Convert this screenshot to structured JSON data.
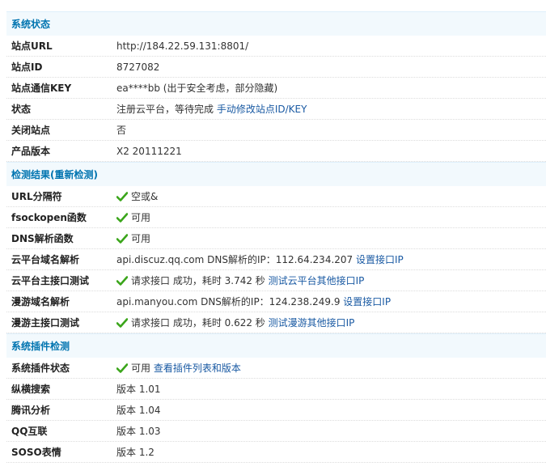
{
  "status": {
    "header": "系统状态",
    "rows": [
      {
        "label": "站点URL",
        "value": "http://184.22.59.131:8801/"
      },
      {
        "label": "站点ID",
        "value": "8727082"
      },
      {
        "label": "站点通信KEY",
        "value": "ea****bb (出于安全考虑，部分隐藏)"
      },
      {
        "label": "状态",
        "value": "注册云平台，等待完成 ",
        "link": "手动修改站点ID/KEY"
      },
      {
        "label": "关闭站点",
        "value": "否"
      },
      {
        "label": "产品版本",
        "value": "X2 20111221"
      }
    ]
  },
  "detect": {
    "header": "检测结果(重新检测)",
    "rows": [
      {
        "label": "URL分隔符",
        "value": "空或&"
      },
      {
        "label": "fsockopen函数",
        "value": "可用"
      },
      {
        "label": "DNS解析函数",
        "value": "可用"
      },
      {
        "label": "云平台域名解析",
        "value": "api.discuz.qq.com DNS解析的IP：112.64.234.207 ",
        "link": "设置接口IP"
      },
      {
        "label": "云平台主接口测试",
        "value": "请求接口 成功，耗时 3.742 秒 ",
        "link": "测试云平台其他接口IP"
      },
      {
        "label": "漫游域名解析",
        "value": "api.manyou.com DNS解析的IP：124.238.249.9 ",
        "link": "设置接口IP"
      },
      {
        "label": "漫游主接口测试",
        "value": "请求接口 成功，耗时 0.622 秒 ",
        "link": "测试漫游其他接口IP"
      }
    ]
  },
  "plugins": {
    "header": "系统插件检测",
    "rows": [
      {
        "label": "系统插件状态",
        "value": "可用 ",
        "link": "查看插件列表和版本"
      },
      {
        "label": "纵横搜索",
        "value": "版本 1.01"
      },
      {
        "label": "腾讯分析",
        "value": "版本 1.04"
      },
      {
        "label": "QQ互联",
        "value": "版本 1.03"
      },
      {
        "label": "SOSO表情",
        "value": "版本 1.2"
      }
    ]
  },
  "icons": {
    "check": "check-icon"
  },
  "colors": {
    "accent": "#0074b0",
    "link": "#1a5aa3",
    "check": "#3aa51a",
    "header_bg": "#f2f9fd"
  }
}
